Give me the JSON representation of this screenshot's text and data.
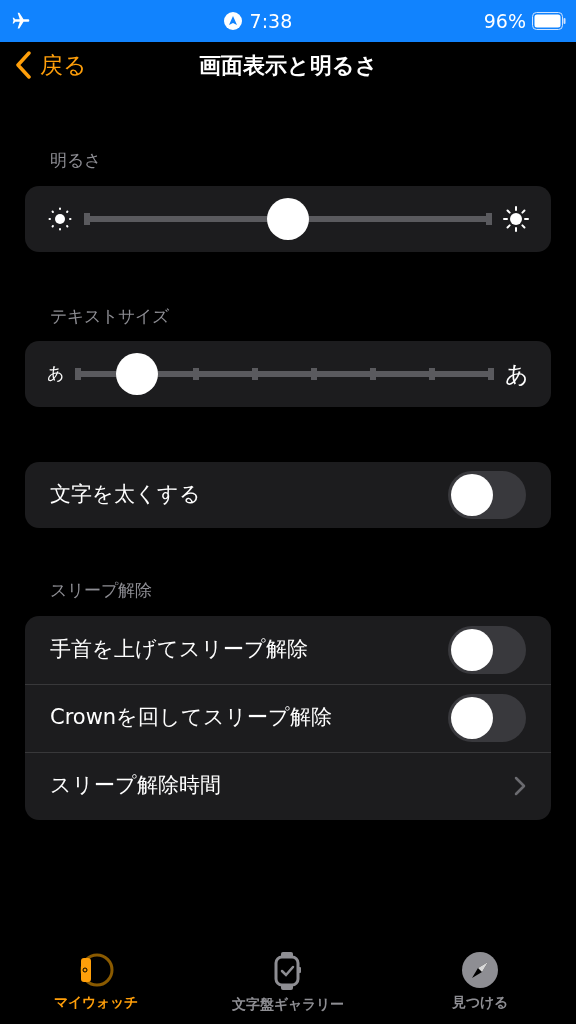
{
  "status_bar": {
    "time": "7:38",
    "battery": "96%"
  },
  "nav": {
    "back": "戻る",
    "title": "画面表示と明るさ"
  },
  "brightness": {
    "label": "明るさ",
    "level": 0.5
  },
  "text_size": {
    "label": "テキストサイズ",
    "small": "あ",
    "large": "あ",
    "level": 0.143
  },
  "bold_text": {
    "label": "文字を太くする",
    "on": false
  },
  "wake": {
    "label": "スリープ解除",
    "rows": [
      {
        "kind": "toggle",
        "label": "手首を上げてスリープ解除",
        "on": false
      },
      {
        "kind": "toggle",
        "label": "Crownを回してスリープ解除",
        "on": false
      },
      {
        "kind": "link",
        "label": "スリープ解除時間"
      }
    ]
  },
  "tabs": [
    {
      "label": "マイウォッチ",
      "selected": true
    },
    {
      "label": "文字盤ギャラリー",
      "selected": false
    },
    {
      "label": "見つける",
      "selected": false
    }
  ]
}
